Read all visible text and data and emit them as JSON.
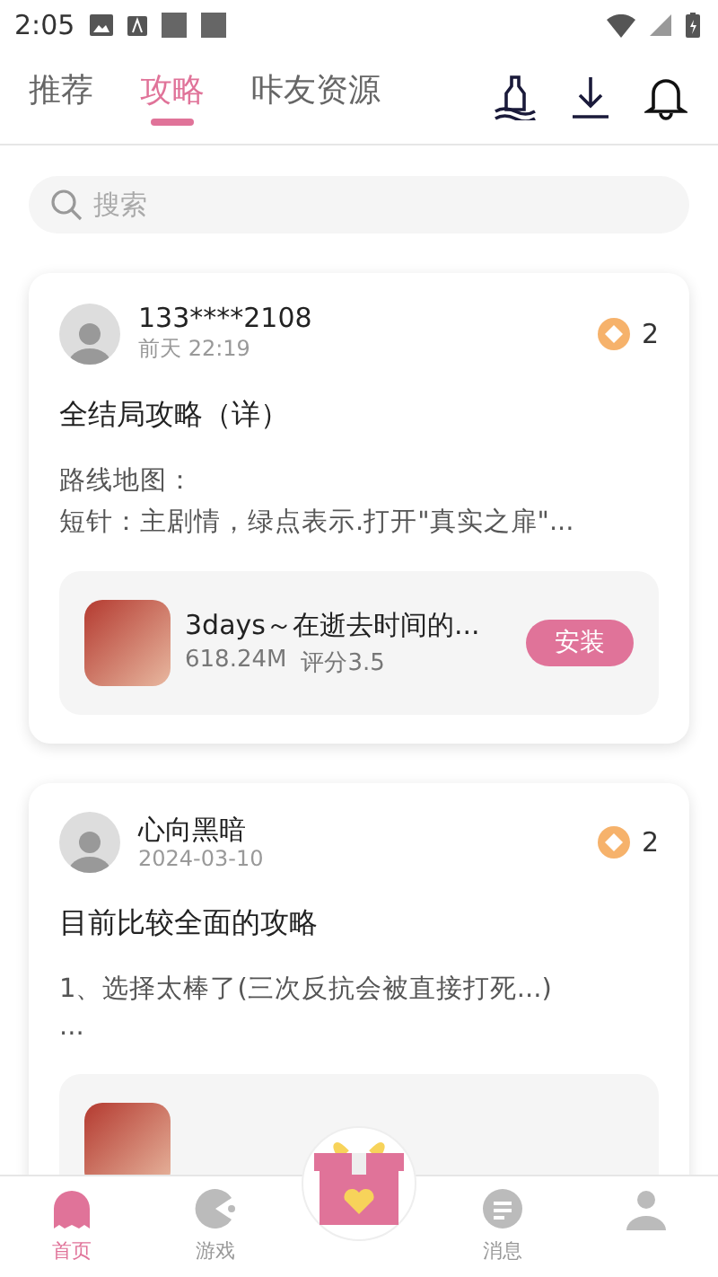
{
  "status_bar": {
    "time": "2:05"
  },
  "tabs": [
    {
      "label": "推荐",
      "selected": false
    },
    {
      "label": "攻略",
      "selected": true
    },
    {
      "label": "咔友资源",
      "selected": false
    }
  ],
  "search": {
    "placeholder": "搜索"
  },
  "posts": [
    {
      "user": "133****2108",
      "time": "前天 22:19",
      "coins": "2",
      "title": "全结局攻略（详）",
      "body": [
        "路线地图：",
        "短针：主剧情，绿点表示.打开\"真实之扉\"..."
      ],
      "app": {
        "name": "3days～在逝去时间的...",
        "size": "618.24M",
        "rating": "评分3.5",
        "button": "安装"
      }
    },
    {
      "user": "心向黑暗",
      "time": "2024-03-10",
      "coins": "2",
      "title": "目前比较全面的攻略",
      "body": [
        "1、选择太棒了(三次反抗会被直接打死...)",
        "..."
      ]
    }
  ],
  "nav": [
    {
      "kind": "home",
      "label": "首页",
      "selected": true
    },
    {
      "kind": "games",
      "label": "游戏",
      "selected": false
    },
    {
      "kind": "gift",
      "selected": false
    },
    {
      "kind": "messages",
      "label": "消息",
      "selected": false
    },
    {
      "kind": "profile",
      "selected": false
    }
  ]
}
